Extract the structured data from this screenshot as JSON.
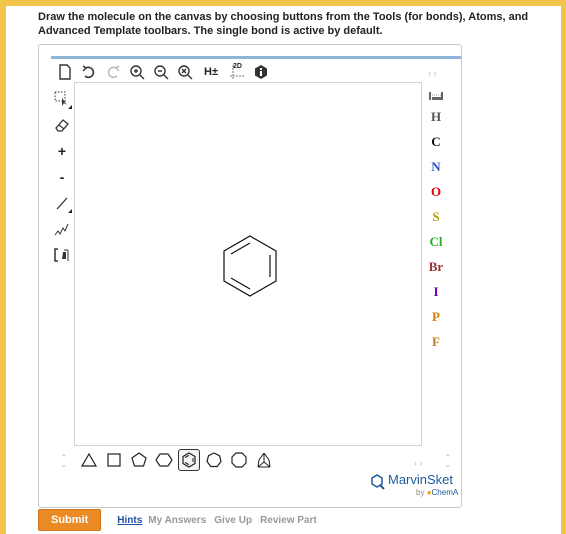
{
  "instructions": "Draw the molecule on the canvas by choosing buttons from the Tools (for bonds), Atoms, and Advanced Template toolbars. The single bond is active by default.",
  "toolbar_top": {
    "items": [
      "new-document-icon",
      "undo-icon",
      "redo-icon",
      "zoom-in-icon",
      "zoom-out-icon",
      "zoom-reset-icon",
      "h-toggle",
      "clean-2d-icon",
      "info-icon"
    ],
    "h_label": "H±",
    "clean_label": "2D"
  },
  "toolbar_left": {
    "items": [
      "select-icon",
      "eraser-icon",
      "plus-charge",
      "minus-charge",
      "single-bond-icon",
      "chain-icon",
      "bracket-icon"
    ],
    "plus_label": "+",
    "minus_label": "-"
  },
  "atoms": [
    {
      "symbol": "H",
      "color": "#555555"
    },
    {
      "symbol": "C",
      "color": "#111111"
    },
    {
      "symbol": "N",
      "color": "#3050c8"
    },
    {
      "symbol": "O",
      "color": "#e00000"
    },
    {
      "symbol": "S",
      "color": "#b0a000"
    },
    {
      "symbol": "Cl",
      "color": "#20b020"
    },
    {
      "symbol": "Br",
      "color": "#a03030"
    },
    {
      "symbol": "I",
      "color": "#7000a0"
    },
    {
      "symbol": "P",
      "color": "#d08000"
    },
    {
      "symbol": "F",
      "color": "#c08020"
    }
  ],
  "templates": {
    "items": [
      "triangle",
      "square",
      "pentagon",
      "hexagon",
      "benzene",
      "heptagon",
      "octagon",
      "bicyclic"
    ],
    "active": "benzene"
  },
  "logo": {
    "name": "MarvinSket",
    "by": "by",
    "company": "ChemA"
  },
  "footer": {
    "submit": "Submit",
    "hints": "Hints",
    "my_answers": "My Answers",
    "give_up": "Give Up",
    "review_part": "Review Part"
  },
  "colors": {
    "accent_border": "#f2c44c",
    "submit": "#ea8a25",
    "link": "#1f4fa0"
  }
}
